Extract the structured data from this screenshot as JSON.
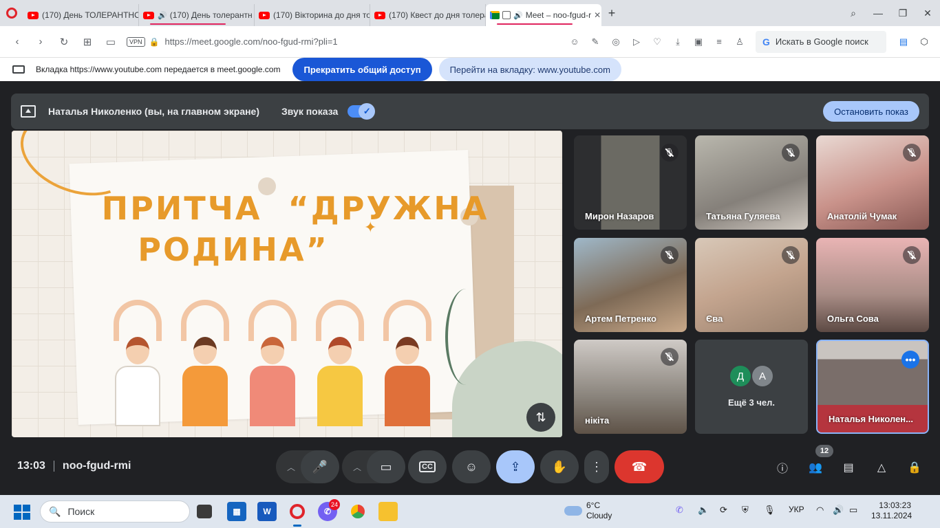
{
  "browser": {
    "tabs": [
      {
        "title": "(170) День ТОЛЕРАНТНО",
        "type": "youtube",
        "audio": false,
        "active": false
      },
      {
        "title": "(170) День толерантн",
        "type": "youtube",
        "audio": true,
        "active": false
      },
      {
        "title": "(170) Вікторина до дня то",
        "type": "youtube",
        "audio": false,
        "active": false
      },
      {
        "title": "(170) Квест до дня толера",
        "type": "youtube",
        "audio": false,
        "active": false
      },
      {
        "title": "Meet – noo-fgud-r",
        "type": "meet",
        "audio": true,
        "active": true
      }
    ],
    "url": "https://meet.google.com/noo-fgud-rmi?pli=1",
    "vpn_label": "VPN",
    "search_placeholder": "Искать в Google поиск"
  },
  "share_bar": {
    "message": "Вкладка https://www.youtube.com передается в meet.google.com",
    "stop_button": "Прекратить общий доступ",
    "goto_button": "Перейти на вкладку: www.youtube.com"
  },
  "meet": {
    "presenting_text": "Наталья Николенко (вы, на главном экране)",
    "sound_label": "Звук показа",
    "stop_present_button": "Остановить показ",
    "slide": {
      "title_line1": "ПРИТЧА  “ДРУЖНА",
      "title_line2": "РОДИНА”"
    },
    "participants": [
      {
        "name": "Мирон Назаров",
        "muted": true
      },
      {
        "name": "Татьяна Гуляева",
        "muted": true
      },
      {
        "name": "Анатолій Чумак",
        "muted": true
      },
      {
        "name": "Артем Петренко",
        "muted": true
      },
      {
        "name": "Єва",
        "muted": true
      },
      {
        "name": "Ольга Сова",
        "muted": true
      },
      {
        "name": "нікіта",
        "muted": true
      }
    ],
    "more_tile": {
      "avatar1": "Д",
      "avatar2": "А",
      "label": "Ещё 3 чел."
    },
    "self_tile": {
      "name": "Наталья Николен..."
    },
    "time": "13:03",
    "meeting_code": "noo-fgud-rmi",
    "participant_count": "12"
  },
  "taskbar": {
    "search_label": "Поиск",
    "viber_badge": "24",
    "weather_temp": "6°C",
    "weather_desc": "Cloudy",
    "language": "УКР",
    "clock_time": "13:03:23",
    "clock_date": "13.11.2024"
  },
  "colors": {
    "meet_bg": "#202124",
    "accent_blue": "#1a57d6",
    "end_call_red": "#dc362e",
    "slide_title": "#e79a2a"
  }
}
